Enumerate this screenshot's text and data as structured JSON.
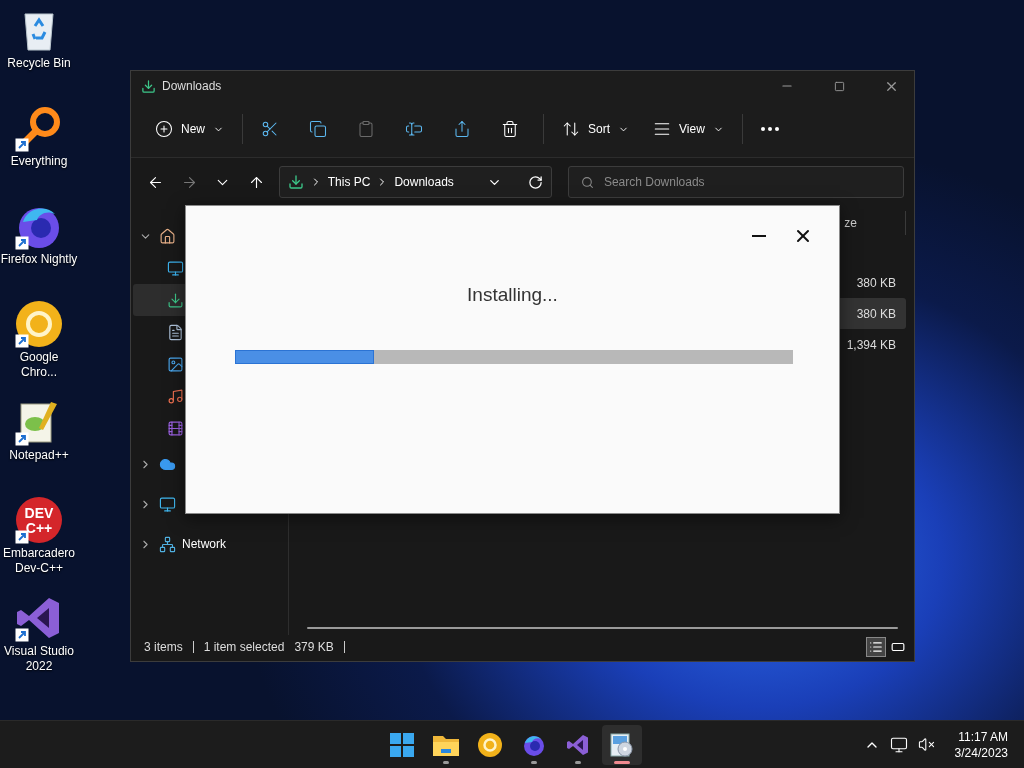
{
  "desktop_icons": [
    {
      "kind": "recycle",
      "label": "Recycle Bin"
    },
    {
      "kind": "everything",
      "label": "Everything",
      "shortcut": true
    },
    {
      "kind": "firefox",
      "label": "Firefox Nightly",
      "shortcut": true
    },
    {
      "kind": "chrome",
      "label": "Google Chro...",
      "shortcut": true
    },
    {
      "kind": "notepad",
      "label": "Notepad++",
      "shortcut": true
    },
    {
      "kind": "devcpp",
      "label": "Embarcadero Dev-C++",
      "shortcut": true,
      "icon_text": [
        "DEV",
        "C++"
      ]
    },
    {
      "kind": "vs",
      "label": "Visual Studio 2022",
      "shortcut": true
    }
  ],
  "explorer": {
    "title": "Downloads",
    "command_groups": [
      [
        {
          "kind": "new",
          "label": "New",
          "disabled": false
        }
      ],
      [
        {
          "kind": "cut",
          "disabled": false
        },
        {
          "kind": "copy",
          "disabled": false
        },
        {
          "kind": "paste",
          "disabled": true
        },
        {
          "kind": "rename",
          "disabled": false
        },
        {
          "kind": "share",
          "disabled": false
        },
        {
          "kind": "delete",
          "disabled": false
        }
      ],
      [
        {
          "kind": "sort",
          "label": "Sort",
          "disabled": false
        },
        {
          "kind": "view",
          "label": "View",
          "disabled": false
        }
      ],
      [
        {
          "kind": "more",
          "disabled": false
        }
      ]
    ],
    "nav": [
      {
        "kind": "back",
        "disabled": false
      },
      {
        "kind": "forward",
        "disabled": true
      },
      {
        "kind": "recent",
        "disabled": false
      },
      {
        "kind": "up",
        "disabled": false
      }
    ],
    "address": {
      "segments": [
        "This PC",
        "Downloads"
      ]
    },
    "search": {
      "placeholder": "Search Downloads"
    },
    "sidebar": [
      {
        "kind": "home",
        "expanded": true,
        "selected": false,
        "children": [
          {
            "kind": "desktop",
            "selected": false
          },
          {
            "kind": "downloads",
            "selected": true
          },
          {
            "kind": "documents",
            "selected": false
          },
          {
            "kind": "pictures",
            "selected": false
          },
          {
            "kind": "music",
            "selected": false
          },
          {
            "kind": "videos",
            "selected": false
          }
        ]
      },
      {
        "kind": "onedrive",
        "expanded": false,
        "selected": false
      },
      {
        "kind": "thispc",
        "expanded": false,
        "selected": false
      },
      {
        "kind": "network",
        "label": "Network",
        "expanded": false,
        "selected": false
      }
    ],
    "column_header": "ze",
    "rows": [
      {
        "size": "380 KB",
        "selected": false
      },
      {
        "size": "380 KB",
        "selected": true
      },
      {
        "size": "1,394 KB",
        "selected": false
      }
    ],
    "status_bar": {
      "items": "3 items",
      "selection": "1 item selected",
      "size": "379 KB"
    },
    "views": [
      {
        "kind": "details",
        "selected": true
      },
      {
        "kind": "tiles",
        "selected": false
      }
    ]
  },
  "dialog": {
    "message": "Installing...",
    "progress": {
      "level": 0.25
    }
  },
  "taskbar": {
    "apps": [
      {
        "kind": "start",
        "running": false,
        "attention": false
      },
      {
        "kind": "explorer",
        "running": true,
        "attention": false
      },
      {
        "kind": "chrome",
        "running": false,
        "attention": false
      },
      {
        "kind": "firefox",
        "running": true,
        "attention": false
      },
      {
        "kind": "vs",
        "running": true,
        "attention": false
      },
      {
        "kind": "installer",
        "running": true,
        "attention": true
      }
    ],
    "time": "11:17 AM",
    "date": "3/24/2023"
  }
}
